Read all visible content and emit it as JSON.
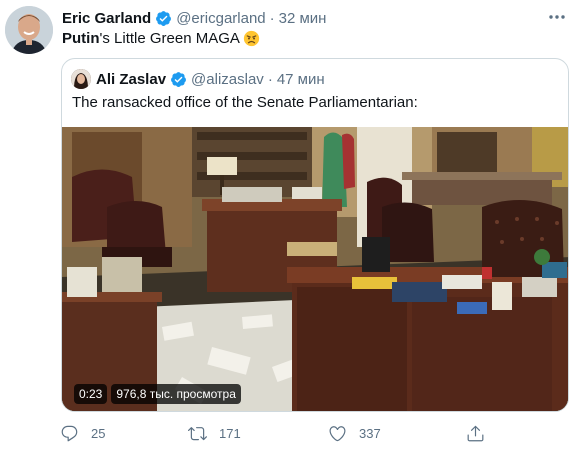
{
  "tweet": {
    "author_name": "Eric Garland",
    "author_handle": "@ericgarland",
    "separator": "·",
    "time": "32 мин",
    "more_icon": "more-icon",
    "text_bold": "Putin",
    "text_rest": "'s Little Green MAGA",
    "emoji": "angry-face-emoji"
  },
  "quote": {
    "author_name": "Ali Zaslav",
    "author_handle": "@alizaslav",
    "separator": "·",
    "time": "47 мин",
    "text": "The ransacked office of the Senate Parliamentarian:",
    "video": {
      "duration": "0:23",
      "views": "976,8 тыс. просмотра"
    }
  },
  "actions": {
    "reply_count": "25",
    "retweet_count": "171",
    "like_count": "337"
  },
  "colors": {
    "text": "#0f1419",
    "secondary": "#5b7083",
    "verified": "#1d9bf0",
    "border": "#cfd9de"
  }
}
